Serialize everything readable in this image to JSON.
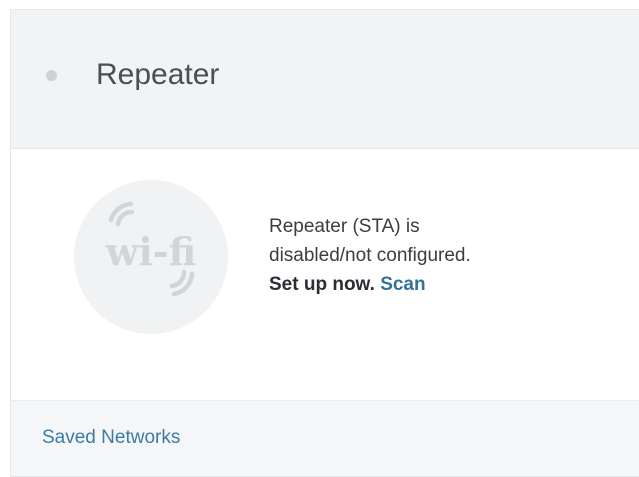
{
  "header": {
    "title": "Repeater",
    "status_color": "#cfd1d4"
  },
  "body": {
    "logo_icon": "wifi-logo-icon",
    "logo_text": "wi-fi",
    "status_line1": "Repeater (STA) is",
    "status_line2": "disabled/not configured.",
    "setup_label": "Set up now.",
    "scan_label": "Scan"
  },
  "footer": {
    "saved_networks_label": "Saved Networks"
  },
  "colors": {
    "link": "#3d7aa6",
    "header_bg": "#f2f3f5",
    "footer_bg": "#f5f6f7"
  }
}
